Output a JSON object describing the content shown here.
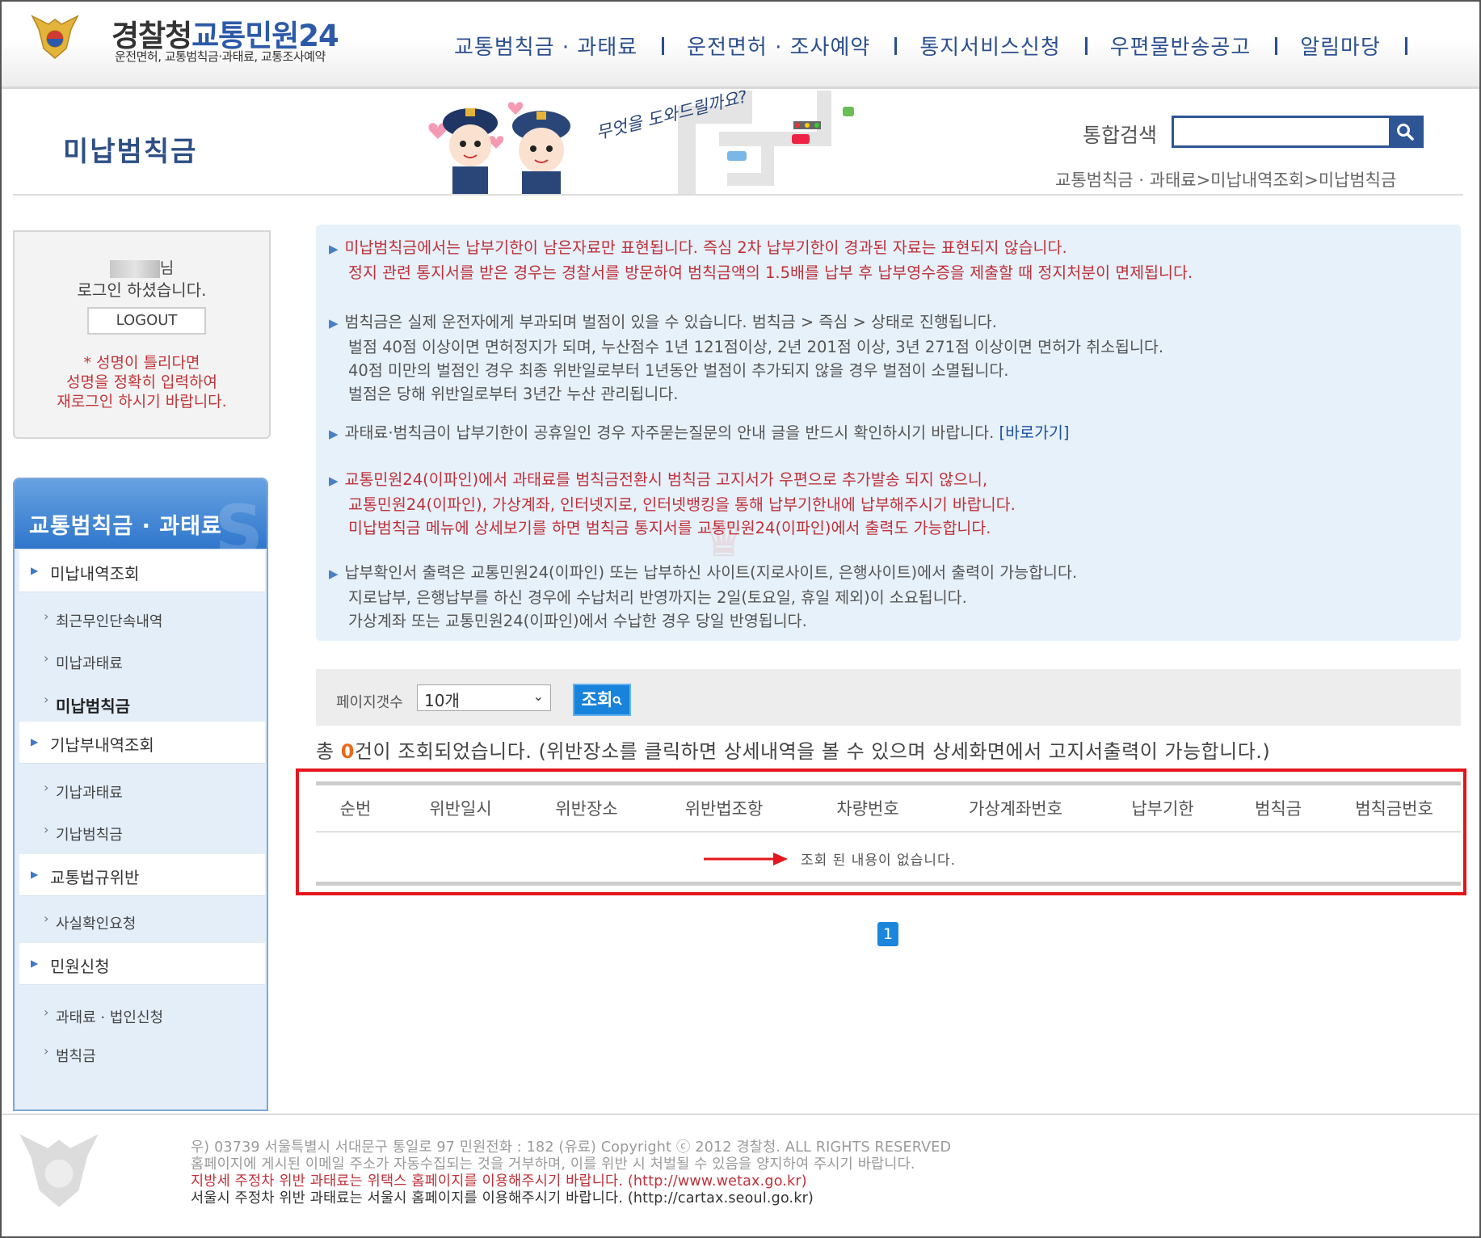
{
  "header": {
    "logo_main": "경찰청",
    "logo_brand": "교통민원24",
    "logo_subtitle": "운전면허, 교통범칙금·과태료, 교통조사예약",
    "nav": [
      "교통범칙금 · 과태료",
      "운전면허 · 조사예약",
      "통지서비스신청",
      "우편물반송공고",
      "알림마당"
    ]
  },
  "page": {
    "title": "미납범칙금",
    "banner_text": "무엇을 도와드릴까요?",
    "search_label": "통합검색",
    "search_value": "",
    "breadcrumb": "교통범칙금 · 과태료>미납내역조회>미납범칙금"
  },
  "login": {
    "suffix": "님",
    "message": "로그인 하셨습니다.",
    "logout_label": "LOGOUT",
    "warning_lines": [
      "* 성명이 틀리다면",
      "성명을 정확히 입력하여",
      "재로그인 하시기 바랍니다."
    ]
  },
  "sidebar": {
    "title": "교통범칙금 · 과태료",
    "items": [
      {
        "label": "미납내역조회",
        "level": 1
      },
      {
        "label": "최근무인단속내역",
        "level": 2
      },
      {
        "label": "미납과태료",
        "level": 2
      },
      {
        "label": "미납범칙금",
        "level": 2,
        "active": true
      },
      {
        "label": "기납부내역조회",
        "level": 1
      },
      {
        "label": "기납과태료",
        "level": 2
      },
      {
        "label": "기납범칙금",
        "level": 2
      },
      {
        "label": "교통법규위반",
        "level": 1
      },
      {
        "label": "사실확인요청",
        "level": 2
      },
      {
        "label": "민원신청",
        "level": 1
      },
      {
        "label": "과태료 · 법인신청",
        "level": 2
      },
      {
        "label": "범칙금",
        "level": 2
      }
    ]
  },
  "notice": {
    "p1": [
      "미납범칙금에서는 납부기한이 남은자료만 표현됩니다. 즉심 2차 납부기한이 경과된 자료는 표현되지 않습니다.",
      "정지 관련 통지서를 받은 경우는 경찰서를 방문하여 범칙금액의 1.5배를 납부 후 납부영수증을 제출할 때 정지처분이 면제됩니다."
    ],
    "p2": [
      "범칙금은 실제 운전자에게 부과되며 벌점이 있을 수 있습니다. 범칙금 > 즉심 > 상태로 진행됩니다.",
      "벌점 40점 이상이면 면허정지가 되며, 누산점수 1년 121점이상, 2년 201점 이상, 3년 271점 이상이면 면허가 취소됩니다.",
      "40점 미만의 벌점인 경우 최종 위반일로부터 1년동안 벌점이 추가되지 않을 경우 벌점이 소멸됩니다.",
      "벌점은 당해 위반일로부터 3년간 누산 관리됩니다."
    ],
    "p3_text": "과태료·범칙금이 납부기한이 공휴일인 경우 자주묻는질문의 안내 글을 반드시 확인하시기 바랍니다.",
    "p3_link": "[바로가기]",
    "p4": [
      "교통민원24(이파인)에서 과태료를 범칙금전환시 범칙금 고지서가 우편으로 추가발송 되지 않으니,",
      "교통민원24(이파인), 가상계좌, 인터넷지로, 인터넷뱅킹을 통해 납부기한내에 납부해주시기 바랍니다.",
      "미납범칙금 메뉴에 상세보기를 하면 범칙금 통지서를 교통민원24(이파인)에서 출력도 가능합니다."
    ],
    "p5": [
      "납부확인서 출력은 교통민원24(이파인) 또는 납부하신 사이트(지로사이트, 은행사이트)에서 출력이 가능합니다.",
      "지로납부, 은행납부를 하신 경우에 수납처리 반영까지는 2일(토요일, 휴일 제외)이 소요됩니다.",
      "가상계좌 또는 교통민원24(이파인)에서 수납한 경우 당일 반영됩니다."
    ]
  },
  "filter": {
    "page_size_label": "페이지갯수",
    "page_size_value": "10개",
    "query_label": "조회"
  },
  "result": {
    "prefix": "총 ",
    "count": "0",
    "suffix": "건이 조회되었습니다. (위반장소를 클릭하면 상세내역을 볼 수 있으며 상세화면에서 고지서출력이 가능합니다.)"
  },
  "table": {
    "columns": [
      "순번",
      "위반일시",
      "위반장소",
      "위반법조항",
      "차량번호",
      "가상계좌번호",
      "납부기한",
      "범칙금",
      "범칙금번호"
    ],
    "empty_message": "조회 된 내용이 없습니다."
  },
  "pagination": {
    "current": "1"
  },
  "footer": {
    "line1": "우) 03739 서울특별시 서대문구 통일로 97  민원전화 : 182 (유료)      Copyright ⓒ 2012 경찰청. ALL RIGHTS RESERVED",
    "line2": "홈페이지에 게시된 이메일 주소가 자동수집되는 것을 거부하며, 이를 위반 시 처벌될 수 있음을 양지하여 주시기 바랍니다.",
    "line3": "지방세 주정차 위반 과태료는 위택스 홈페이지를 이용해주시기 바랍니다. (http://www.wetax.go.kr)",
    "line4": "서울시 주정차 위반 과태료는 서울시 홈페이지를 이용해주시기 바랍니다. (http://cartax.seoul.go.kr)"
  },
  "colors": {
    "brand_blue": "#2c5aa8",
    "nav_blue": "#2b4f8f",
    "notice_red": "#c0303a",
    "highlight_red": "#e3161d",
    "button_blue": "#1783db",
    "count_orange": "#e86a1c"
  },
  "icons": [
    "police-emblem-icon",
    "search-icon",
    "dropdown-chevron-icon",
    "magnifier-icon",
    "red-arrow-icon"
  ]
}
